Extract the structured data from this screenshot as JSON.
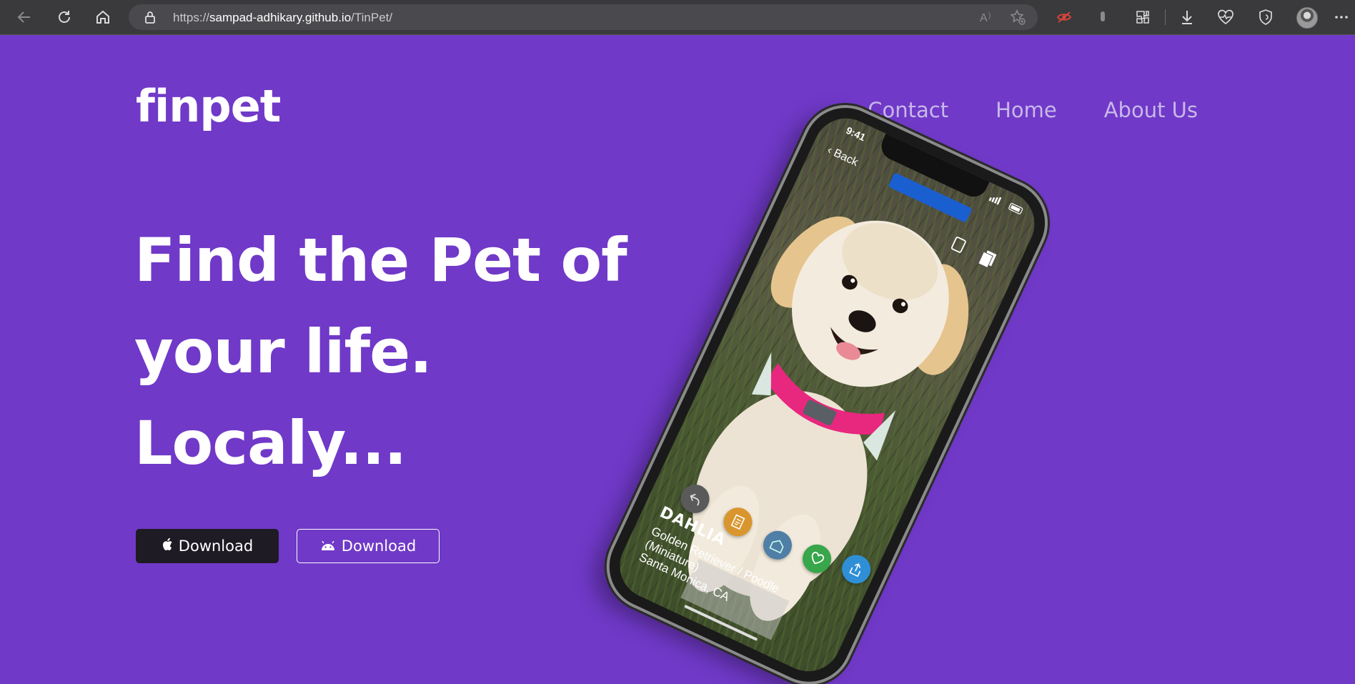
{
  "browser": {
    "url_scheme": "https://",
    "url_host": "sampad-adhikary.github.io",
    "url_path": "/TinPet/",
    "icons": [
      "back-icon",
      "refresh-icon",
      "home-icon",
      "lock-icon",
      "read-aloud-icon",
      "favorite-add-icon",
      "tracking-blocked-icon",
      "extension-pin-icon",
      "extensions-icon",
      "downloads-icon",
      "health-icon",
      "browser-essentials-icon",
      "profile-avatar",
      "more-menu-icon"
    ]
  },
  "site": {
    "logo": "finpet",
    "nav": [
      "Contact",
      "Home",
      "About Us"
    ],
    "headline": [
      "Find the Pet of",
      "your life.",
      "Localy..."
    ],
    "buttons": {
      "ios": {
        "label": "Download",
        "icon": "apple-icon"
      },
      "android": {
        "label": "Download",
        "icon": "android-icon"
      }
    }
  },
  "phone": {
    "time": "9:41",
    "back_label": "Back",
    "dog_name": "DAHLIA",
    "breed_line1": "Golden Retriever / Poodle",
    "breed_line2": "(Miniature)",
    "location": "Santa Monica, CA",
    "action_colors": {
      "rewind": "#5a5a5a",
      "info": "#d9962f",
      "kennel": "#4f7fa6",
      "like": "#38a64a",
      "share": "#2f8fd6"
    }
  },
  "colors": {
    "page_background": "#7039c8",
    "nav_link": "#c8b8ea",
    "ios_button": "#1f1b24"
  }
}
